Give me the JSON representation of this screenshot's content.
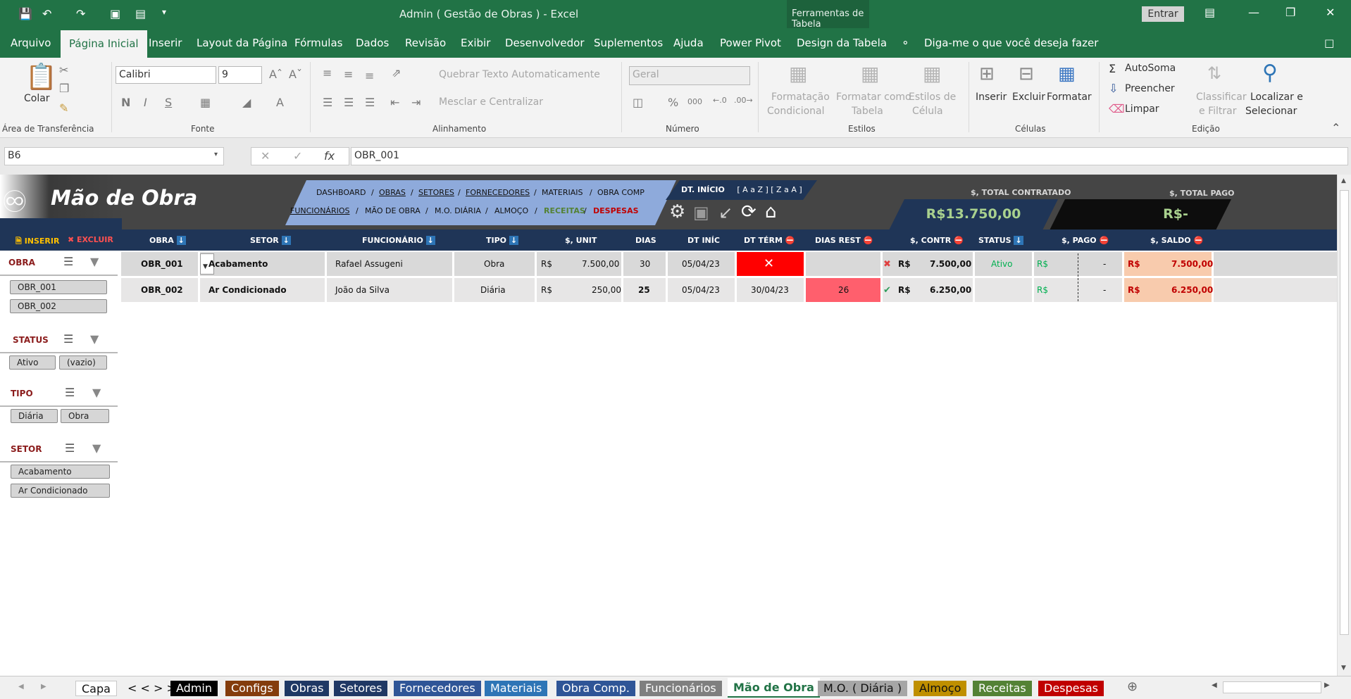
{
  "titlebar": {
    "title": "Admin ( Gestão de Obras )  -  Excel",
    "tool_tab": "Ferramentas de Tabela",
    "entrar": "Entrar"
  },
  "menu": [
    "Arquivo",
    "Página Inicial",
    "Inserir",
    "Layout da Página",
    "Fórmulas",
    "Dados",
    "Revisão",
    "Exibir",
    "Desenvolvedor",
    "Suplementos",
    "Ajuda",
    "Power Pivot",
    "Design da Tabela"
  ],
  "tellme": "Diga-me o que você deseja fazer",
  "ribbon": {
    "colar": "Colar",
    "font_name": "Calibri",
    "font_size": "9",
    "bold": "N",
    "italic": "I",
    "underline": "S",
    "quebrar": "Quebrar Texto Automaticamente",
    "mesclar": "Mesclar e Centralizar",
    "numfmt": "Geral",
    "fmt_cond_1": "Formatação",
    "fmt_cond_2": "Condicional",
    "fmt_tab_1": "Formatar como",
    "fmt_tab_2": "Tabela",
    "est_cel_1": "Estilos de",
    "est_cel_2": "Célula",
    "inserir": "Inserir",
    "excluir": "Excluir",
    "formatar": "Formatar",
    "autosoma": "AutoSoma",
    "preencher": "Preencher",
    "limpar": "Limpar",
    "classificar_1": "Classificar",
    "classificar_2": "e Filtrar",
    "localizar_1": "Localizar e",
    "localizar_2": "Selecionar",
    "groups": {
      "transfer": "Área de Transferência",
      "fonte": "Fonte",
      "alinhamento": "Alinhamento",
      "numero": "Número",
      "estilos": "Estilos",
      "celulas": "Células",
      "edicao": "Edição"
    }
  },
  "formula": {
    "namebox": "B6",
    "fx": "fx",
    "value": "OBR_001"
  },
  "banner": {
    "title": "Mão de Obra",
    "nav_row1": [
      "DASHBOARD",
      "OBRAS",
      "SETORES",
      "FORNECEDORES",
      "MATERIAIS",
      "OBRA COMP"
    ],
    "nav_row2": [
      "FUNCIONÁRIOS",
      "MÃO DE OBRA",
      "M.O. DIÁRIA",
      "ALMOÇO",
      "RECEITAS",
      "DESPESAS"
    ],
    "dt_label": "DT. INÍCIO",
    "sort": "[ A a Z ] [ Z a A ]",
    "total_contratado_label": "$, TOTAL CONTRATADO",
    "total_contratado": "R$13.750,00",
    "total_pago_label": "$, TOTAL PAGO",
    "total_pago": "R$-",
    "inserir": "INSERIR",
    "excluir": "EXCLUIR"
  },
  "headers": [
    "OBRA",
    "SETOR",
    "FUNCIONÁRIO",
    "TIPO",
    "$, UNIT",
    "DIAS",
    "DT INÍC",
    "DT TÉRM",
    "DIAS REST",
    "$, CONTR",
    "STATUS",
    "$, PAGO",
    "$, SALDO"
  ],
  "rows": [
    {
      "obra": "OBR_001",
      "setor": "Acabamento",
      "func": "Rafael Assugeni",
      "tipo": "Obra",
      "rs": "R$",
      "unit": "7.500,00",
      "dias": "30",
      "ini": "05/04/23",
      "term": "",
      "rest": "",
      "contr": "7.500,00",
      "status": "Ativo",
      "pago": "-",
      "saldo": "7.500,00"
    },
    {
      "obra": "OBR_002",
      "setor": "Ar Condicionado",
      "func": "João da Silva",
      "tipo": "Diária",
      "rs": "R$",
      "unit": "250,00",
      "dias": "25",
      "ini": "05/04/23",
      "term": "30/04/23",
      "rest": "26",
      "contr": "6.250,00",
      "status": "",
      "pago": "-",
      "saldo": "6.250,00"
    }
  ],
  "slicers": {
    "obra": {
      "title": "OBRA",
      "items": [
        "OBR_001",
        "OBR_002"
      ]
    },
    "status": {
      "title": "STATUS",
      "items": [
        "Ativo",
        "(vazio)"
      ]
    },
    "tipo": {
      "title": "TIPO",
      "items": [
        "Diária",
        "Obra"
      ]
    },
    "setor": {
      "title": "SETOR",
      "items": [
        "Acabamento",
        "Ar Condicionado"
      ]
    }
  },
  "sheet_tabs": [
    {
      "label": "Capa",
      "color": "#ffffff",
      "fg": "#111111"
    },
    {
      "label": "< < > >",
      "color": "#f0f0f0",
      "fg": "#111111"
    },
    {
      "label": "Admin",
      "color": "#000000",
      "fg": "#ffffff"
    },
    {
      "label": "Configs",
      "color": "#843c0c",
      "fg": "#ffffff"
    },
    {
      "label": "Obras",
      "color": "#1f3864",
      "fg": "#ffffff"
    },
    {
      "label": "Setores",
      "color": "#203864",
      "fg": "#ffffff"
    },
    {
      "label": "Fornecedores",
      "color": "#2f5597",
      "fg": "#ffffff"
    },
    {
      "label": "Materiais",
      "color": "#2e75b6",
      "fg": "#ffffff"
    },
    {
      "label": "Obra Comp.",
      "color": "#2f5597",
      "fg": "#ffffff"
    },
    {
      "label": "Funcionários",
      "color": "#7f7f7f",
      "fg": "#ffffff"
    },
    {
      "label": "Mão de Obra",
      "color": "#ffffff",
      "fg": "#217346"
    },
    {
      "label": "M.O. ( Diária )",
      "color": "#a6a6a6",
      "fg": "#111111"
    },
    {
      "label": "Almoço",
      "color": "#bf8f00",
      "fg": "#111111"
    },
    {
      "label": "Receitas",
      "color": "#548235",
      "fg": "#ffffff"
    },
    {
      "label": "Despesas",
      "color": "#c00000",
      "fg": "#ffffff"
    }
  ]
}
